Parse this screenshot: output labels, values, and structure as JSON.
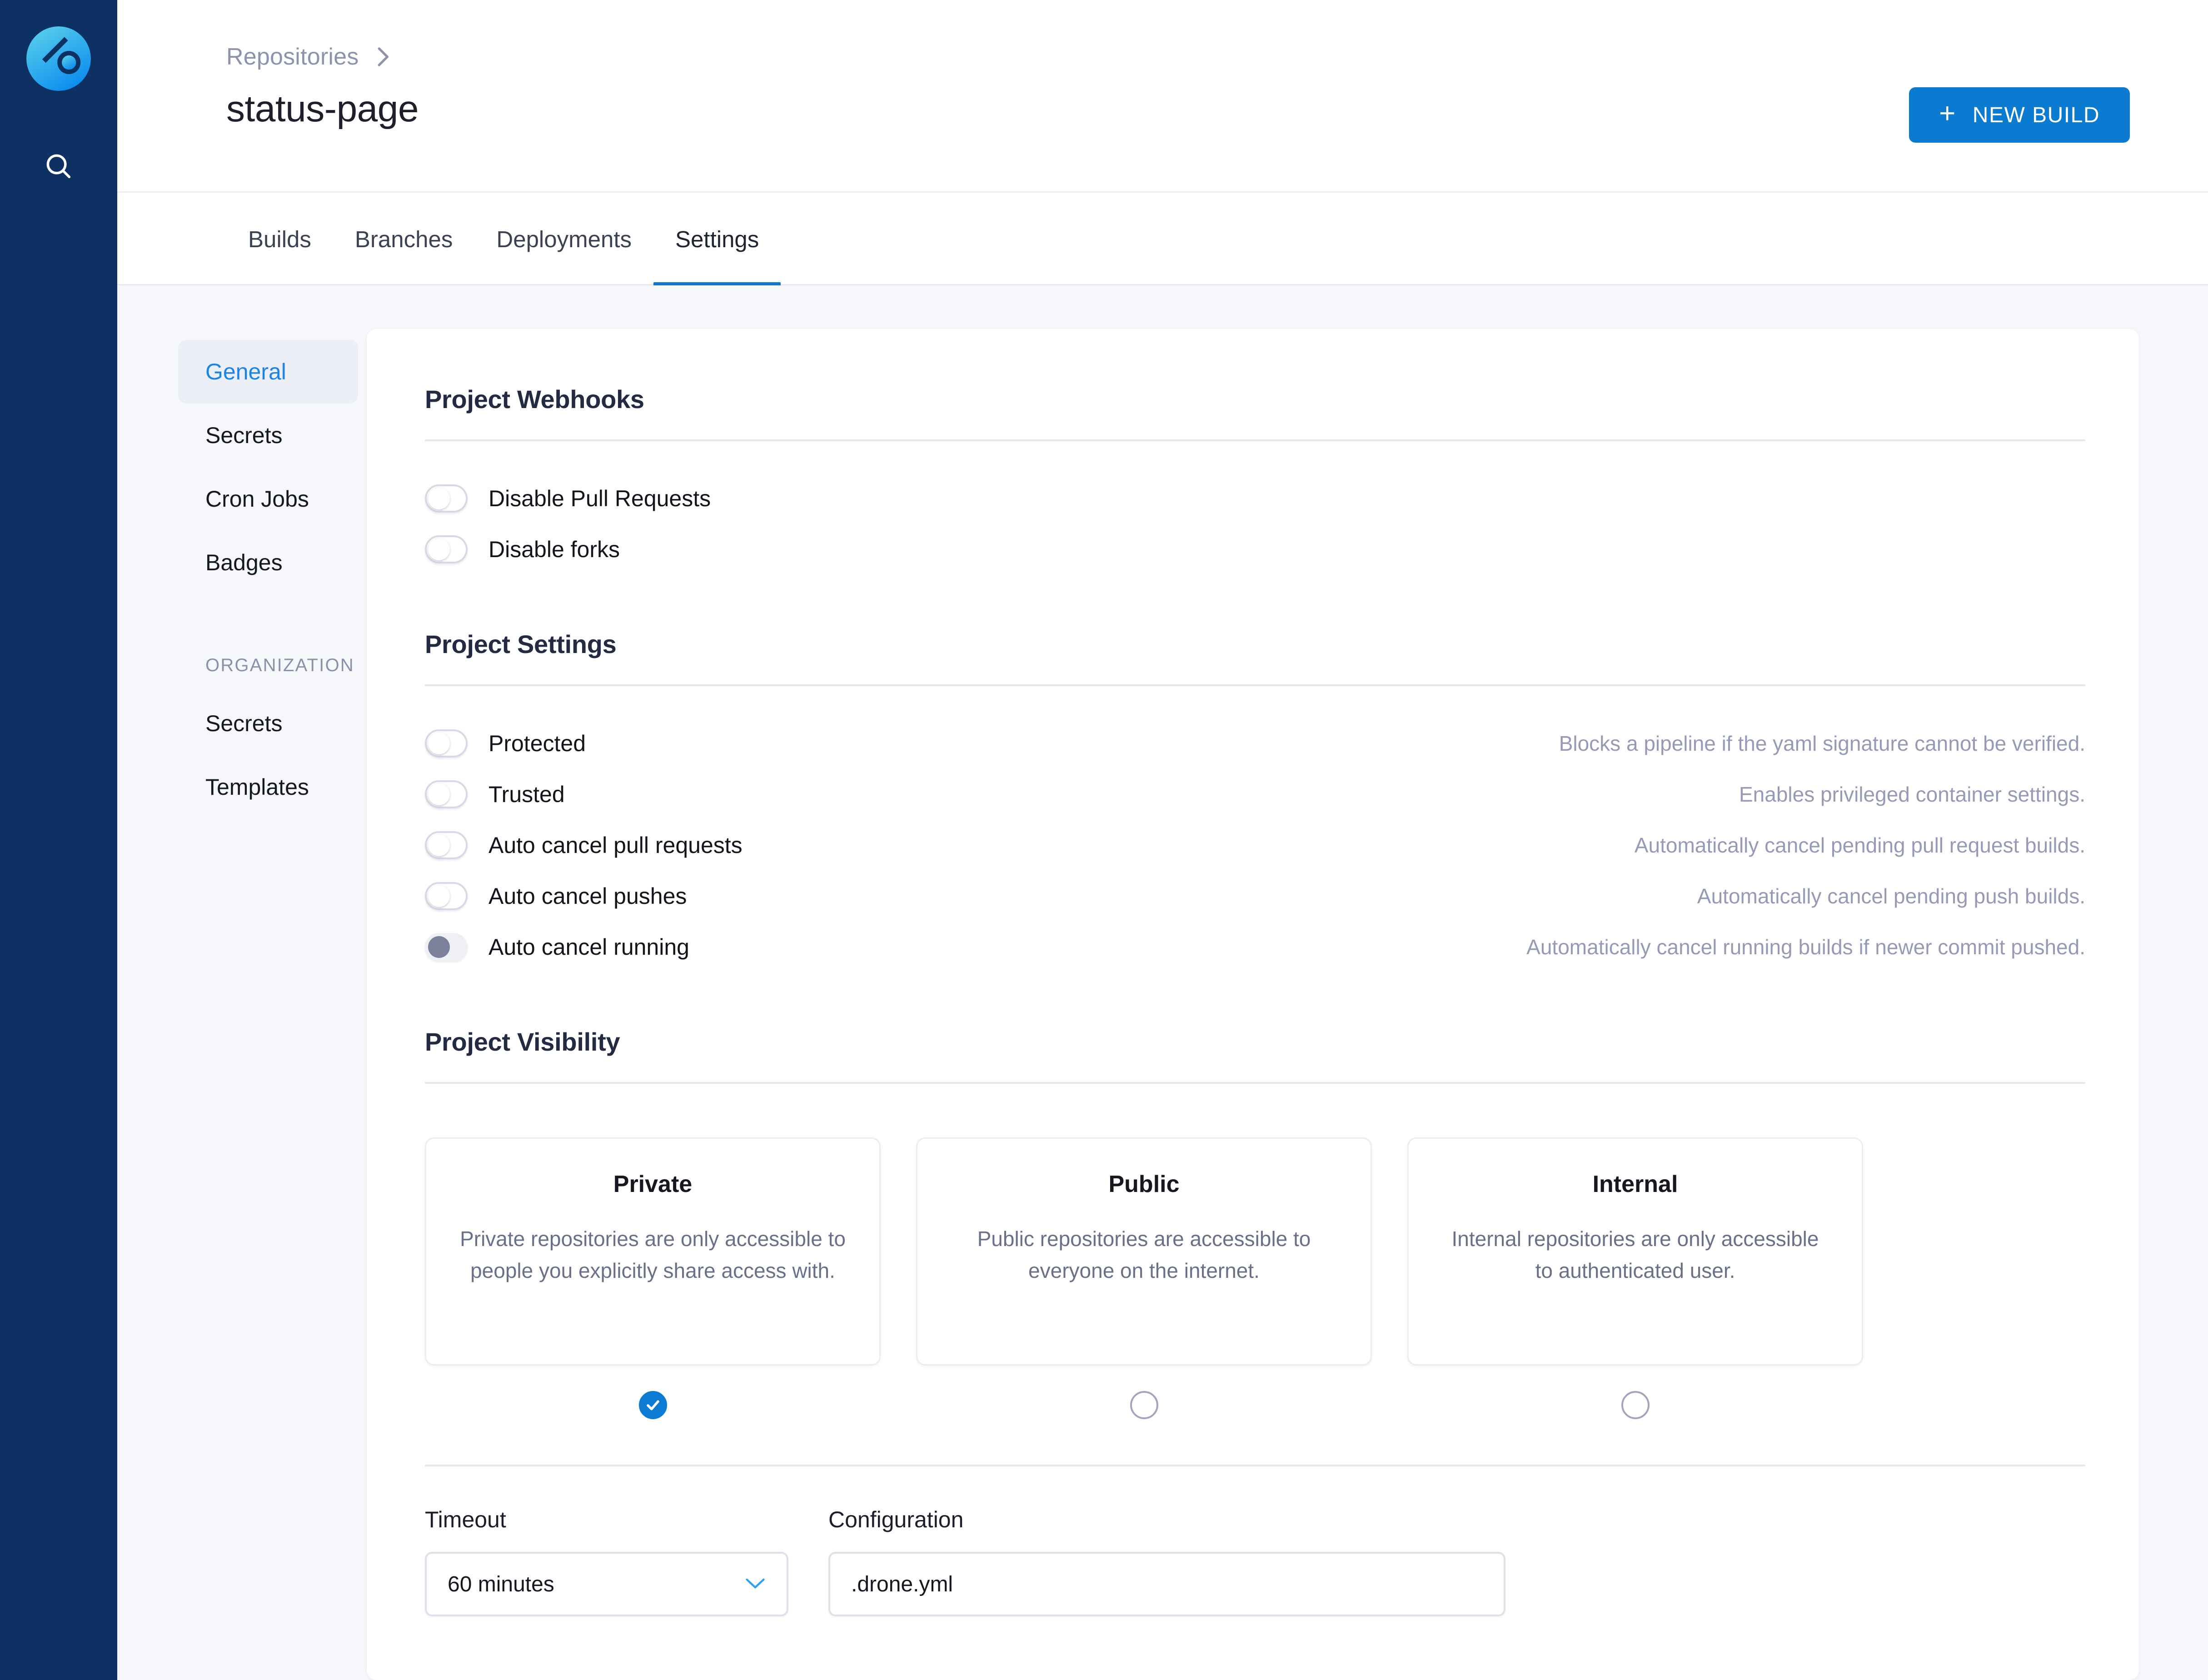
{
  "brand": {
    "logo_icon": "drone-logo-icon",
    "accent_blue": "#0b7ad1",
    "rail_navy": "#0d3163"
  },
  "rail": {
    "search_icon": "search-icon"
  },
  "header": {
    "breadcrumb_root": "Repositories",
    "breadcrumb_separator_icon": "chevron-right-icon",
    "title": "status-page",
    "new_build_label": "NEW BUILD",
    "new_build_icon": "plus-icon"
  },
  "tabs": [
    {
      "label": "Builds",
      "active": false
    },
    {
      "label": "Branches",
      "active": false
    },
    {
      "label": "Deployments",
      "active": false
    },
    {
      "label": "Settings",
      "active": true
    }
  ],
  "settings_nav": {
    "items": [
      {
        "label": "General",
        "active": true
      },
      {
        "label": "Secrets",
        "active": false
      },
      {
        "label": "Cron Jobs",
        "active": false
      },
      {
        "label": "Badges",
        "active": false
      }
    ],
    "group_label": "ORGANIZATION",
    "org_items": [
      {
        "label": "Secrets",
        "active": false
      },
      {
        "label": "Templates",
        "active": false
      }
    ]
  },
  "webhooks": {
    "title": "Project Webhooks",
    "toggles": [
      {
        "label": "Disable Pull Requests",
        "state": "off",
        "desc": ""
      },
      {
        "label": "Disable forks",
        "state": "off",
        "desc": ""
      }
    ]
  },
  "project_settings": {
    "title": "Project Settings",
    "toggles": [
      {
        "label": "Protected",
        "state": "off",
        "desc": "Blocks a pipeline if the yaml signature cannot be verified."
      },
      {
        "label": "Trusted",
        "state": "off",
        "desc": "Enables privileged container settings."
      },
      {
        "label": "Auto cancel pull requests",
        "state": "off",
        "desc": "Automatically cancel pending pull request builds."
      },
      {
        "label": "Auto cancel pushes",
        "state": "off",
        "desc": "Automatically cancel pending push builds."
      },
      {
        "label": "Auto cancel running",
        "state": "muted",
        "desc": "Automatically cancel running builds if newer commit pushed."
      }
    ]
  },
  "visibility": {
    "title": "Project Visibility",
    "options": [
      {
        "name": "Private",
        "desc": "Private repositories are only accessible to people you explicitly share access with.",
        "selected": true
      },
      {
        "name": "Public",
        "desc": "Public repositories are accessible to everyone on the internet.",
        "selected": false
      },
      {
        "name": "Internal",
        "desc": "Internal repositories are only accessible to authenticated user.",
        "selected": false
      }
    ]
  },
  "form": {
    "timeout_label": "Timeout",
    "timeout_value": "60 minutes",
    "timeout_chevron_icon": "chevron-down-icon",
    "configuration_label": "Configuration",
    "configuration_value": ".drone.yml",
    "configuration_placeholder": ".drone.yml"
  }
}
